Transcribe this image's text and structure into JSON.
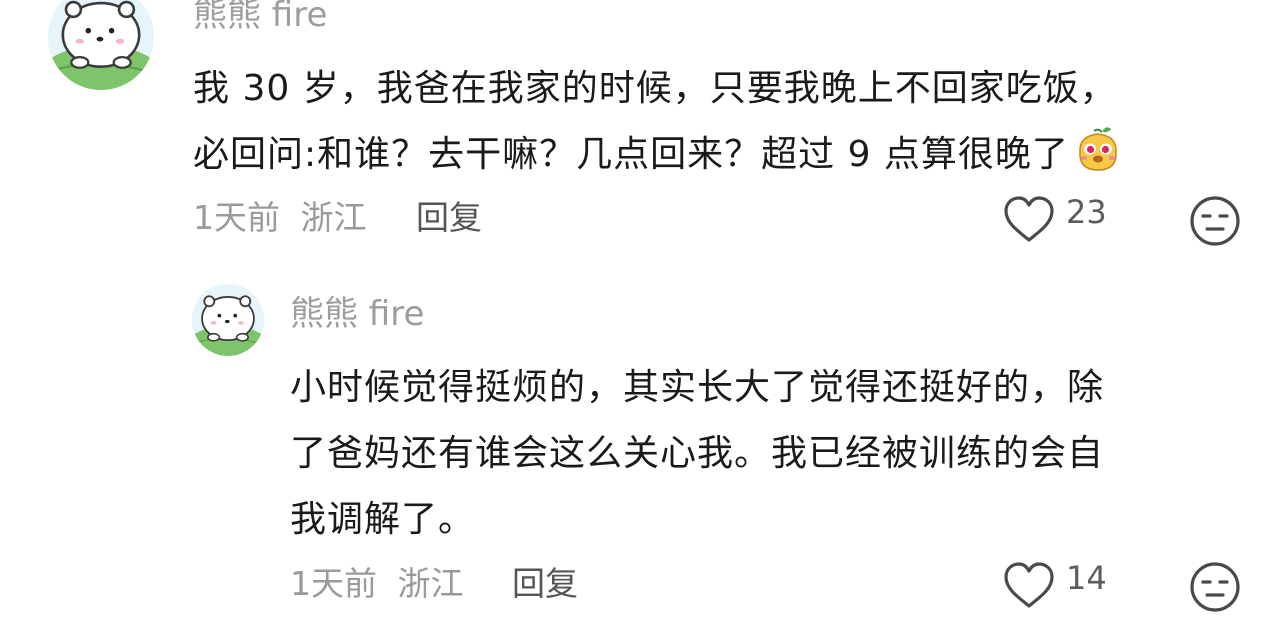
{
  "comment": {
    "username": "熊熊 fire",
    "lines": [
      "我 30 岁，我爸在我家的时候，只要我晚上不回家吃饭，",
      "必回问:和谁？去干嘛？几点回来？超过 9 点算很晚了"
    ],
    "emoji_icon": "cute-fruit-emoji-icon",
    "time": "1天前",
    "location": "浙江",
    "reply_label": "回复",
    "like_count": "23"
  },
  "reply": {
    "username": "熊熊 fire",
    "lines": [
      "小时候觉得挺烦的，其实长大了觉得还挺好的，除",
      "了爸妈还有谁会这么关心我。我已经被训练的会自",
      "我调解了。"
    ],
    "time": "1天前",
    "location": "浙江",
    "reply_label": "回复",
    "like_count": "14"
  },
  "icons": {
    "like": "heart-icon",
    "dislike": "unimpressed-face-icon",
    "avatar": "polar-bear-avatar"
  },
  "colors": {
    "text_primary": "#1a1a1a",
    "text_secondary": "#9a9a9a",
    "text_reply_button": "#555555",
    "icon_stroke": "#4a4a4a",
    "avatar_grass": "#7dc46a"
  }
}
